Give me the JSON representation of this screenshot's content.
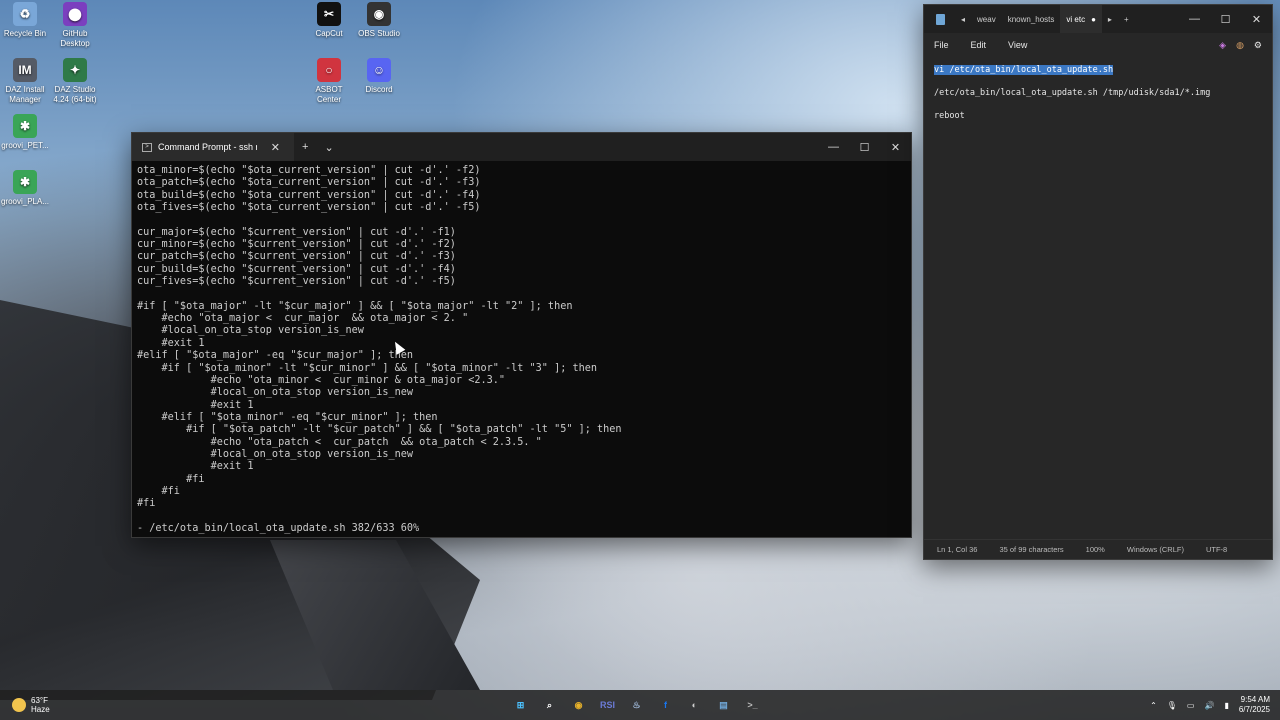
{
  "desktop": {
    "icons": [
      {
        "name": "recycle-bin-icon",
        "label": "Recycle Bin",
        "glyph": "♻",
        "color": "#7aa7d8"
      },
      {
        "name": "github-desktop-icon",
        "label": "GitHub\nDesktop",
        "glyph": "⬤",
        "color": "#7b3fbf"
      },
      {
        "name": "daz-install-manager-icon",
        "label": "DAZ Install\nManager",
        "glyph": "IM",
        "color": "#555b66"
      },
      {
        "name": "daz-studio-icon",
        "label": "DAZ Studio\n4.24 (64-bit)",
        "glyph": "✦",
        "color": "#2f7a48"
      },
      {
        "name": "groovi-pet-icon",
        "label": "groovi_PET...",
        "glyph": "✱",
        "color": "#3aa557"
      },
      {
        "name": "groovi-pla-icon",
        "label": "groovi_PLA...",
        "glyph": "✱",
        "color": "#3aa557"
      },
      {
        "name": "capcut-icon",
        "label": "CapCut",
        "glyph": "✂",
        "color": "#111111"
      },
      {
        "name": "obs-studio-icon",
        "label": "OBS Studio",
        "glyph": "◉",
        "color": "#333333"
      },
      {
        "name": "asbot-center-icon",
        "label": "ASBOT\nCenter",
        "glyph": "○",
        "color": "#d0343f"
      },
      {
        "name": "discord-icon",
        "label": "Discord",
        "glyph": "☺",
        "color": "#5865f2"
      }
    ]
  },
  "cmd_window": {
    "tab_title": "Command Prompt - ssh root",
    "tab_icon": "terminal-icon",
    "new_tab": "+",
    "dropdown": "⌄",
    "minimize": "—",
    "maximize": "☐",
    "close": "✕",
    "lines": [
      "ota_minor=$(echo \"$ota_current_version\" | cut -d'.' -f2)",
      "ota_patch=$(echo \"$ota_current_version\" | cut -d'.' -f3)",
      "ota_build=$(echo \"$ota_current_version\" | cut -d'.' -f4)",
      "ota_fives=$(echo \"$ota_current_version\" | cut -d'.' -f5)",
      "",
      "cur_major=$(echo \"$current_version\" | cut -d'.' -f1)",
      "cur_minor=$(echo \"$current_version\" | cut -d'.' -f2)",
      "cur_patch=$(echo \"$current_version\" | cut -d'.' -f3)",
      "cur_build=$(echo \"$current_version\" | cut -d'.' -f4)",
      "cur_fives=$(echo \"$current_version\" | cut -d'.' -f5)",
      "",
      "#if [ \"$ota_major\" -lt \"$cur_major\" ] && [ \"$ota_major\" -lt \"2\" ]; then",
      "    #echo \"ota_major <  cur_major  && ota_major < 2. \"",
      "    #local_on_ota_stop version_is_new",
      "    #exit 1",
      "#elif [ \"$ota_major\" -eq \"$cur_major\" ]; then",
      "    #if [ \"$ota_minor\" -lt \"$cur_minor\" ] && [ \"$ota_minor\" -lt \"3\" ]; then",
      "            #echo \"ota_minor <  cur_minor & ota_major <2.3.\"",
      "            #local_on_ota_stop version_is_new",
      "            #exit 1",
      "    #elif [ \"$ota_minor\" -eq \"$cur_minor\" ]; then",
      "        #if [ \"$ota_patch\" -lt \"$cur_patch\" ] && [ \"$ota_patch\" -lt \"5\" ]; then",
      "            #echo \"ota_patch <  cur_patch  && ota_patch < 2.3.5. \"",
      "            #local_on_ota_stop version_is_new",
      "            #exit 1",
      "        #fi",
      "    #fi",
      "#fi",
      ""
    ],
    "status_line": "- /etc/ota_bin/local_ota_update.sh 382/633 60%"
  },
  "notepad": {
    "tabs": [
      {
        "label": "weav"
      },
      {
        "label": "known_hosts"
      },
      {
        "label": "vi etc",
        "active": true
      }
    ],
    "new_tab": "+",
    "menu": [
      "File",
      "Edit",
      "View"
    ],
    "content_lines": [
      {
        "text": "vi /etc/ota_bin/local_ota_update.sh",
        "selected": true
      },
      {
        "text": "/etc/ota_bin/local_ota_update.sh /tmp/udisk/sda1/*.img",
        "selected": false
      },
      {
        "text": "reboot",
        "selected": false
      }
    ],
    "status": {
      "position": "Ln 1, Col 36",
      "selection": "35 of 99 characters",
      "zoom": "100%",
      "line_ending": "Windows (CRLF)",
      "encoding": "UTF-8"
    }
  },
  "taskbar": {
    "weather_temp": "63°F",
    "weather_desc": "Haze",
    "time": "9:54 AM",
    "date": "6/7/2025",
    "apps": [
      {
        "name": "start-button",
        "glyph": "⊞",
        "color": "#4cc2ff"
      },
      {
        "name": "search-icon",
        "glyph": "⌕",
        "color": "#ffffff"
      },
      {
        "name": "chrome-icon",
        "glyph": "◉",
        "color": "#e9b32a"
      },
      {
        "name": "rsi-launcher-icon",
        "glyph": "RSI",
        "color": "#6b7bd6"
      },
      {
        "name": "steam-icon",
        "glyph": "♨",
        "color": "#9fb8d8"
      },
      {
        "name": "facebook-icon",
        "glyph": "f",
        "color": "#1877f2"
      },
      {
        "name": "github-icon",
        "glyph": "◐",
        "color": "#d0d0d0"
      },
      {
        "name": "notepad-icon",
        "glyph": "▤",
        "color": "#6fa6d6"
      },
      {
        "name": "terminal-icon",
        "glyph": ">_",
        "color": "#bbbbbb"
      }
    ]
  }
}
